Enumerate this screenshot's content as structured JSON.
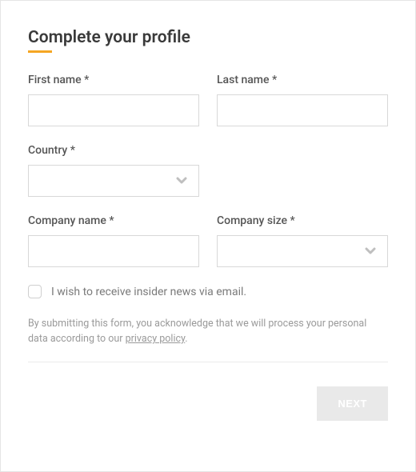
{
  "title": "Complete your profile",
  "fields": {
    "first_name": {
      "label": "First name *",
      "value": ""
    },
    "last_name": {
      "label": "Last name *",
      "value": ""
    },
    "country": {
      "label": "Country *",
      "value": ""
    },
    "company_name": {
      "label": "Company name *",
      "value": ""
    },
    "company_size": {
      "label": "Company size *",
      "value": ""
    }
  },
  "newsletter_checkbox": {
    "checked": false,
    "label": "I wish to receive insider news via email."
  },
  "disclaimer": {
    "prefix": "By submitting this form, you acknowledge that we will process your personal data according to our ",
    "link_text": "privacy policy",
    "suffix": "."
  },
  "next_button": "NEXT"
}
